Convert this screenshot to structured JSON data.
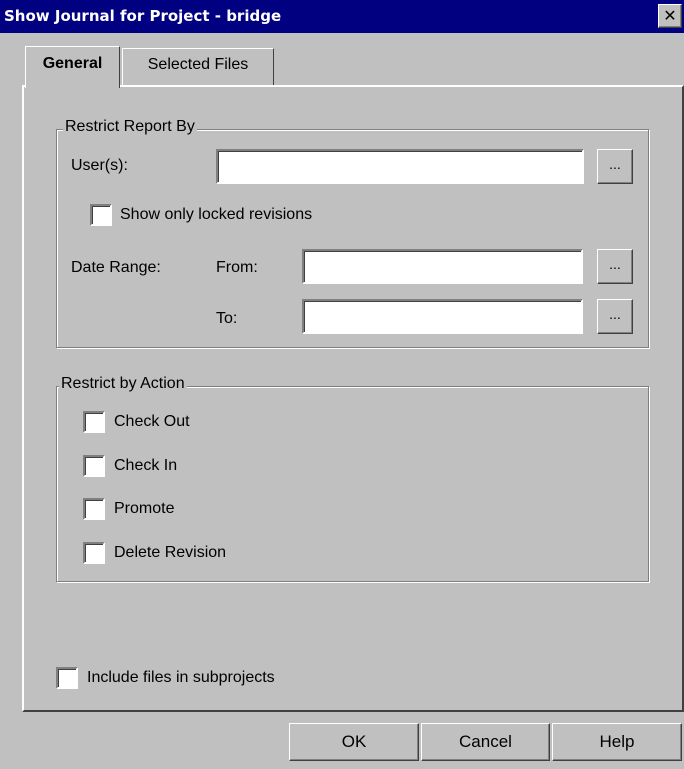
{
  "window": {
    "title": "Show Journal for Project - bridge",
    "close_glyph": "✕"
  },
  "tabs": [
    {
      "label": "General",
      "active": true
    },
    {
      "label": "Selected Files",
      "active": false
    }
  ],
  "restrict_report": {
    "legend": "Restrict Report By",
    "users_label": "User(s):",
    "users_value": "",
    "browse_label": "...",
    "locked_label": "Show only locked revisions",
    "locked_checked": false,
    "date_range_label": "Date Range:",
    "from_label": "From:",
    "from_value": "",
    "to_label": "To:",
    "to_value": ""
  },
  "restrict_action": {
    "legend": "Restrict by Action",
    "items": [
      {
        "label": "Check Out",
        "checked": false
      },
      {
        "label": "Check In",
        "checked": false
      },
      {
        "label": "Promote",
        "checked": false
      },
      {
        "label": "Delete Revision",
        "checked": false
      }
    ]
  },
  "subprojects": {
    "label": "Include files in subprojects",
    "checked": false
  },
  "buttons": {
    "ok": "OK",
    "cancel": "Cancel",
    "help": "Help"
  },
  "colors": {
    "titlebar": "#000080",
    "face": "#c0c0c0",
    "field": "#ffffff"
  }
}
